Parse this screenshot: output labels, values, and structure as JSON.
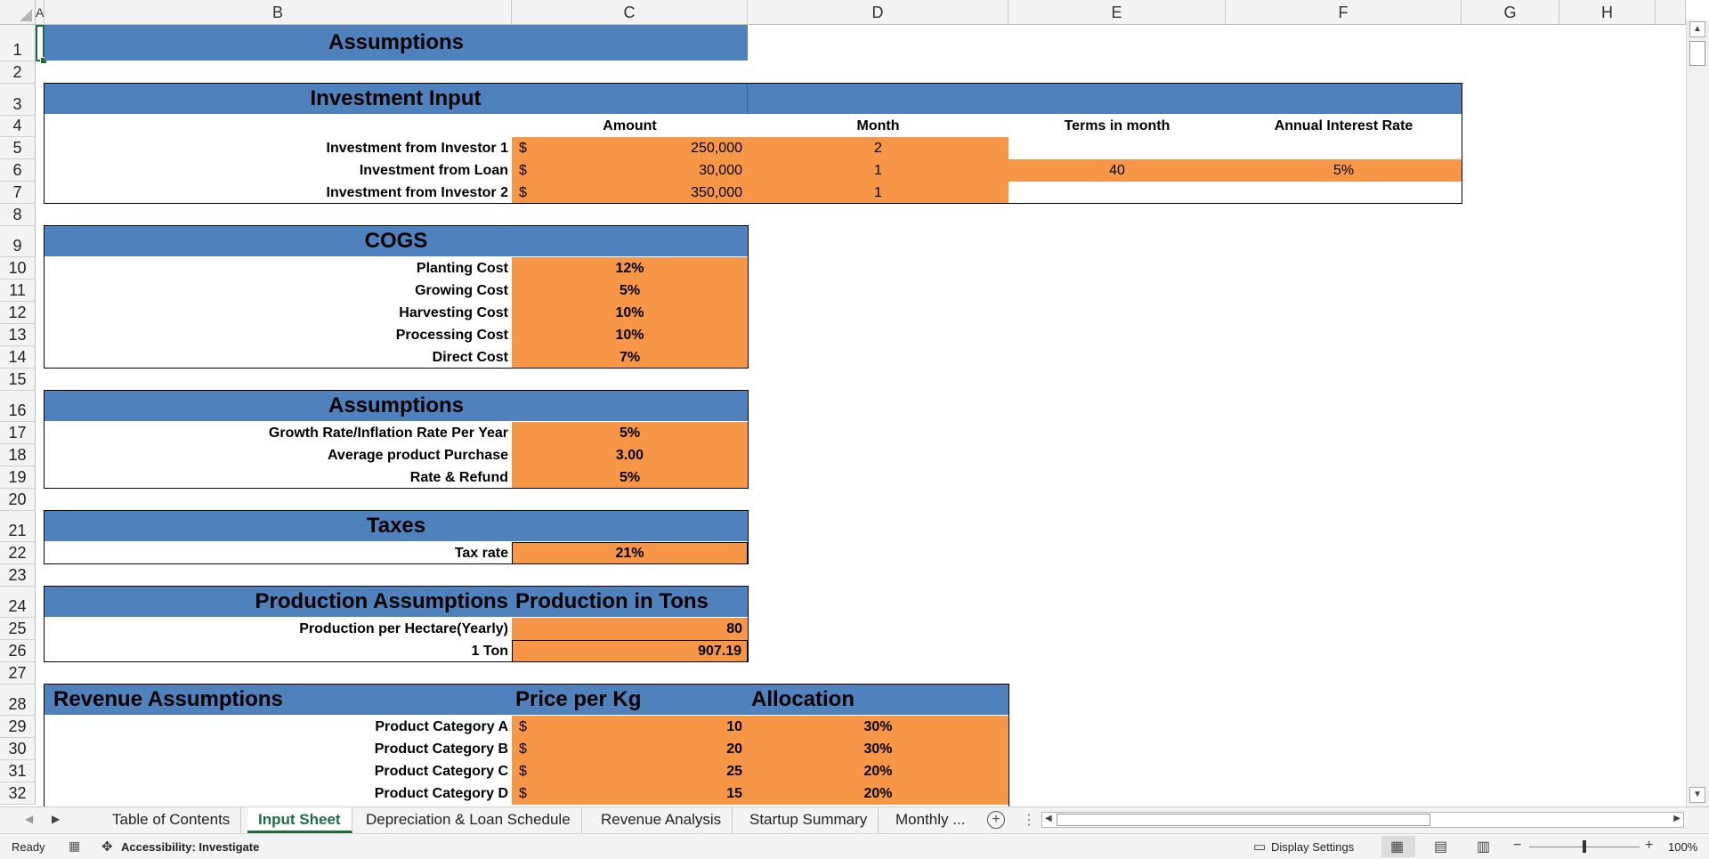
{
  "columns": [
    "A",
    "B",
    "C",
    "D",
    "E",
    "F",
    "G",
    "H"
  ],
  "rows": [
    "1",
    "2",
    "3",
    "4",
    "5",
    "6",
    "7",
    "8",
    "9",
    "10",
    "11",
    "12",
    "13",
    "14",
    "15",
    "16",
    "17",
    "18",
    "19",
    "20",
    "21",
    "22",
    "23",
    "24",
    "25",
    "26",
    "27",
    "28",
    "29",
    "30",
    "31",
    "32"
  ],
  "sections": {
    "assumptions_top": {
      "title": "Assumptions"
    },
    "investment": {
      "title": "Investment Input",
      "col_amount": "Amount",
      "col_month": "Month",
      "col_terms": "Terms in month",
      "col_rate": "Annual Interest Rate",
      "rows": [
        {
          "label": "Investment from Investor 1",
          "cur": "$",
          "amount": "250,000",
          "month": "2"
        },
        {
          "label": "Investment from Loan",
          "cur": "$",
          "amount": "30,000",
          "month": "1",
          "terms": "40",
          "rate": "5%"
        },
        {
          "label": "Investment from Investor 2",
          "cur": "$",
          "amount": "350,000",
          "month": "1"
        }
      ]
    },
    "cogs": {
      "title": "COGS",
      "rows": [
        {
          "label": "Planting Cost",
          "value": "12%"
        },
        {
          "label": "Growing Cost",
          "value": "5%"
        },
        {
          "label": "Harvesting Cost",
          "value": "10%"
        },
        {
          "label": "Processing Cost",
          "value": "10%"
        },
        {
          "label": "Direct Cost",
          "value": "7%"
        }
      ]
    },
    "assumptions": {
      "title": "Assumptions",
      "rows": [
        {
          "label": "Growth Rate/Inflation Rate  Per Year",
          "value": "5%"
        },
        {
          "label": "Average product Purchase",
          "value": "3.00"
        },
        {
          "label": "Rate & Refund",
          "value": "5%"
        }
      ]
    },
    "taxes": {
      "title": "Taxes",
      "rows": [
        {
          "label": "Tax rate",
          "value": "21%"
        }
      ]
    },
    "production": {
      "title": "Production Assumptions",
      "subtitle": "Production in Tons",
      "rows": [
        {
          "label": "Production per Hectare(Yearly)",
          "value": "80"
        },
        {
          "label": "1  Ton",
          "value": "907.19"
        }
      ]
    },
    "revenue": {
      "title": "Revenue Assumptions",
      "col_price": "Price per Kg",
      "col_alloc": "Allocation",
      "rows": [
        {
          "label": "Product Category A",
          "cur": "$",
          "price": "10",
          "alloc": "30%"
        },
        {
          "label": "Product Category B",
          "cur": "$",
          "price": "20",
          "alloc": "30%"
        },
        {
          "label": "Product Category C",
          "cur": "$",
          "price": "25",
          "alloc": "20%"
        },
        {
          "label": "Product Category D",
          "cur": "$",
          "price": "15",
          "alloc": "20%"
        }
      ]
    }
  },
  "tabs": [
    "Table of Contents",
    "Input Sheet",
    "Depreciation & Loan Schedule",
    "Revenue Analysis",
    "Startup Summary",
    "Monthly  ..."
  ],
  "active_tab": "Input Sheet",
  "status": {
    "ready": "Ready",
    "accessibility": "Accessibility: Investigate",
    "display_settings": "Display Settings",
    "zoom": "100%"
  },
  "colors": {
    "header_blue": "#4f81bd",
    "input_orange": "#f79646",
    "active_tab_green": "#1e6e42"
  }
}
